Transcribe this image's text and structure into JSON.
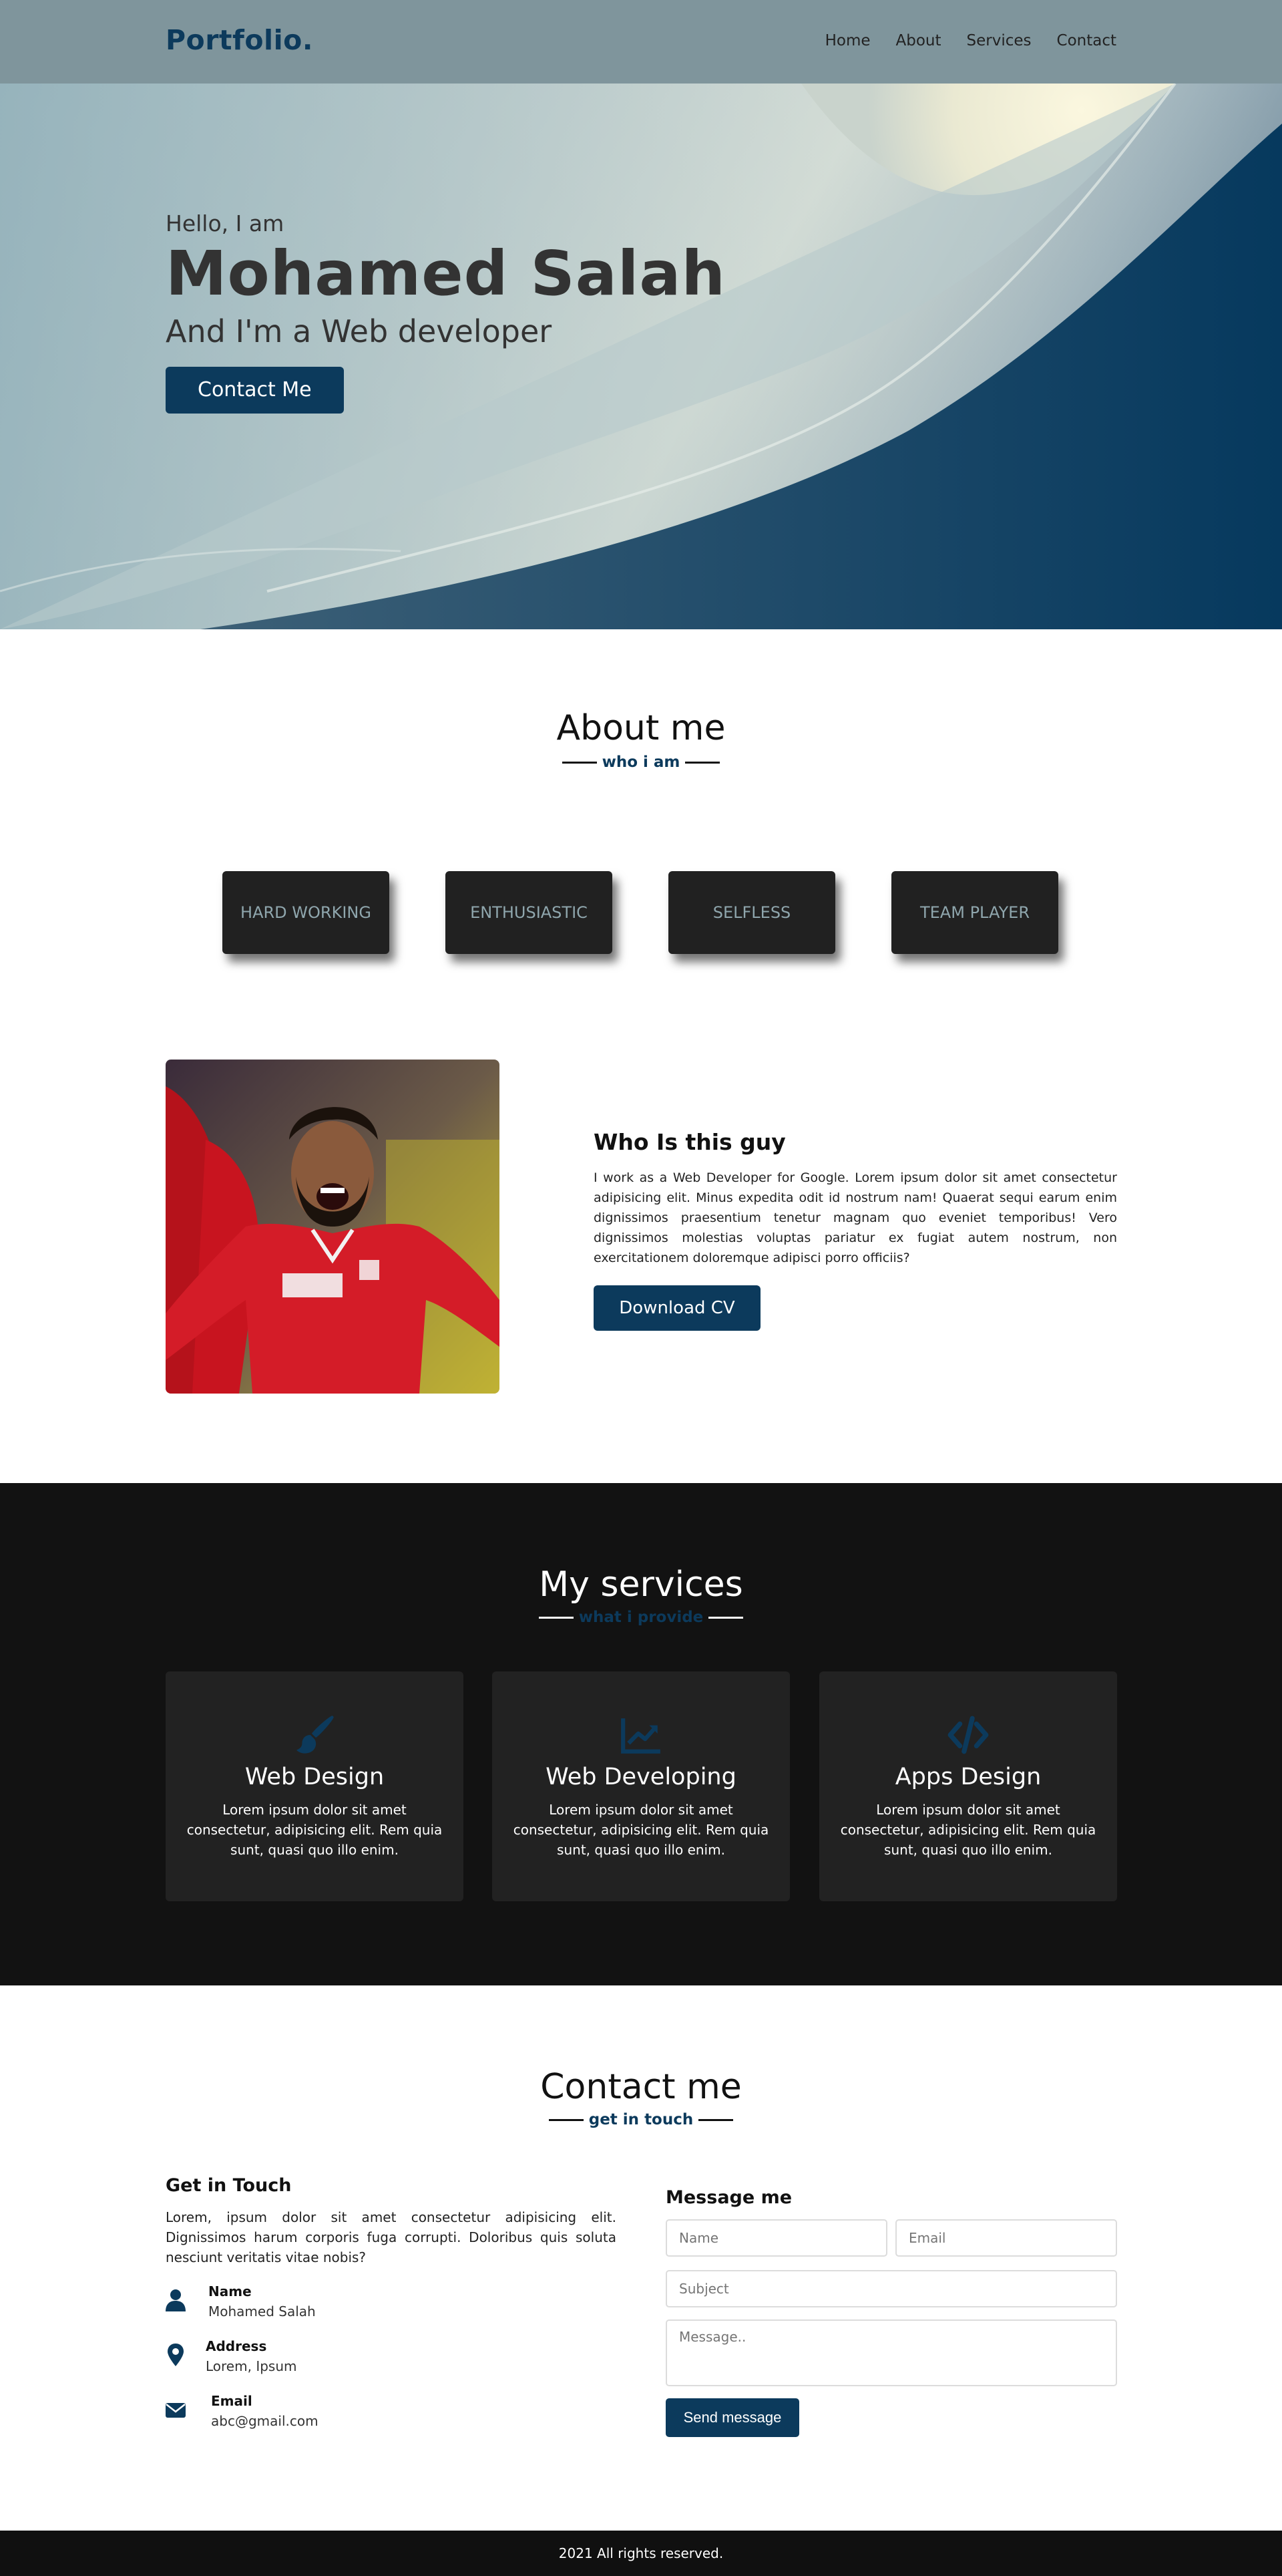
{
  "nav": {
    "logo": "Portfolio.",
    "links": [
      "Home",
      "About",
      "Services",
      "Contact"
    ]
  },
  "hero": {
    "greeting": "Hello, I am",
    "name": "Mohamed Salah",
    "role": "And I'm a Web developer",
    "cta": "Contact Me"
  },
  "about": {
    "title": "About me",
    "subtitle": "who i am",
    "traits": [
      "HARD WORKING",
      "ENTHUSIASTIC",
      "SELFLESS",
      "TEAM PLAYER"
    ],
    "heading": "Who Is this guy",
    "text": "I work as a Web Developer for Google. Lorem ipsum dolor sit amet consectetur adipisicing elit. Minus expedita odit id nostrum nam! Quaerat sequi earum enim dignissimos praesentium tenetur magnam quo eveniet temporibus! Vero dignissimos molestias voluptas pariatur ex fugiat autem nostrum, non exercitationem doloremque adipisci porro officiis?",
    "cv_button": "Download CV",
    "photo_icon": "profile-photo"
  },
  "services": {
    "title": "My services",
    "subtitle": "what i provide",
    "items": [
      {
        "icon": "paintbrush-icon",
        "title": "Web Design",
        "desc": "Lorem ipsum dolor sit amet consectetur, adipisicing elit. Rem quia sunt, quasi quo illo enim."
      },
      {
        "icon": "chart-line-icon",
        "title": "Web Developing",
        "desc": "Lorem ipsum dolor sit amet consectetur, adipisicing elit. Rem quia sunt, quasi quo illo enim."
      },
      {
        "icon": "code-icon",
        "title": "Apps Design",
        "desc": "Lorem ipsum dolor sit amet consectetur, adipisicing elit. Rem quia sunt, quasi quo illo enim."
      }
    ]
  },
  "contact": {
    "title": "Contact me",
    "subtitle": "get in touch",
    "git_title": "Get in Touch",
    "git_text": "Lorem, ipsum dolor sit amet consectetur adipisicing elit. Dignissimos harum corporis fuga corrupti. Doloribus quis soluta nesciunt veritatis vitae nobis?",
    "items": [
      {
        "icon": "user-icon",
        "label": "Name",
        "value": "Mohamed Salah"
      },
      {
        "icon": "map-marker-icon",
        "label": "Address",
        "value": "Lorem, Ipsum"
      },
      {
        "icon": "envelope-icon",
        "label": "Email",
        "value": "abc@gmail.com"
      }
    ],
    "form_title": "Message me",
    "placeholders": {
      "name": "Name",
      "email": "Email",
      "subject": "Subject",
      "message": "Message.."
    },
    "send": "Send message"
  },
  "footer": {
    "text": "2021 All rights reserved."
  },
  "colors": {
    "primary": "#0c3a5c",
    "navbar": "#7f959c",
    "dark": "#121212",
    "card": "#222222"
  }
}
